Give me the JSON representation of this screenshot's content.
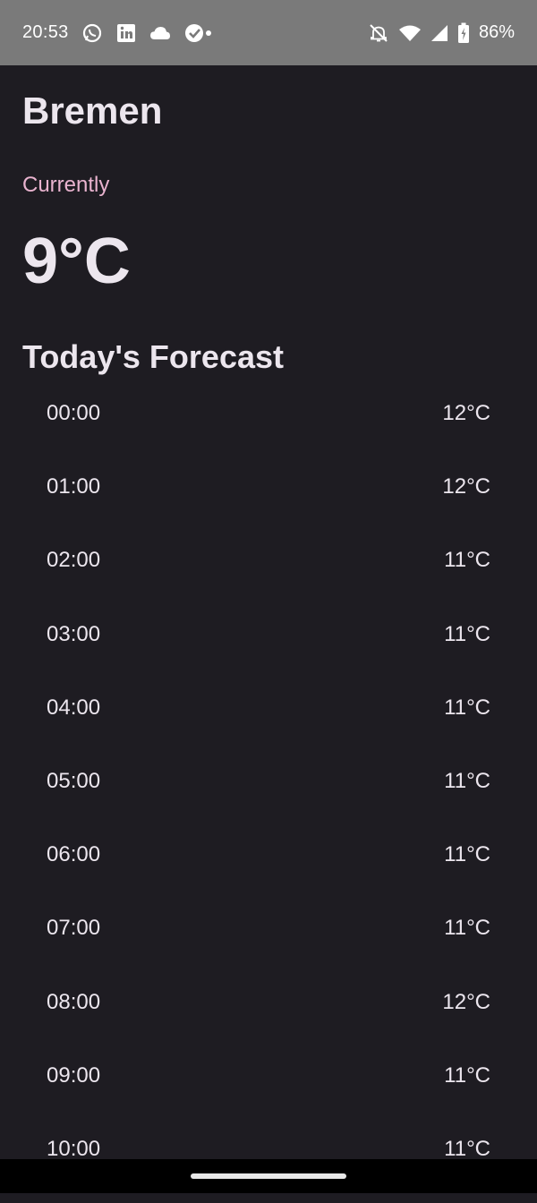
{
  "status_bar": {
    "time": "20:53",
    "notification_icons": [
      "whatsapp-icon",
      "linkedin-icon",
      "cloud-icon",
      "check-circle-icon"
    ],
    "system_icons": [
      "notifications-off-icon",
      "wifi-icon",
      "signal-icon",
      "battery-charging-icon"
    ],
    "battery": "86%"
  },
  "location": {
    "city": "Bremen"
  },
  "current": {
    "label": "Currently",
    "temperature": "9°C"
  },
  "forecast": {
    "title": "Today's Forecast",
    "hours": [
      {
        "time": "00:00",
        "temp": "12°C"
      },
      {
        "time": "01:00",
        "temp": "12°C"
      },
      {
        "time": "02:00",
        "temp": "11°C"
      },
      {
        "time": "03:00",
        "temp": "11°C"
      },
      {
        "time": "04:00",
        "temp": "11°C"
      },
      {
        "time": "05:00",
        "temp": "11°C"
      },
      {
        "time": "06:00",
        "temp": "11°C"
      },
      {
        "time": "07:00",
        "temp": "11°C"
      },
      {
        "time": "08:00",
        "temp": "12°C"
      },
      {
        "time": "09:00",
        "temp": "11°C"
      },
      {
        "time": "10:00",
        "temp": "11°C"
      }
    ]
  },
  "colors": {
    "background": "#1e1c22",
    "status_bar": "#7a7a7a",
    "accent_label": "#e9b3cf",
    "text": "#ece6ee"
  }
}
